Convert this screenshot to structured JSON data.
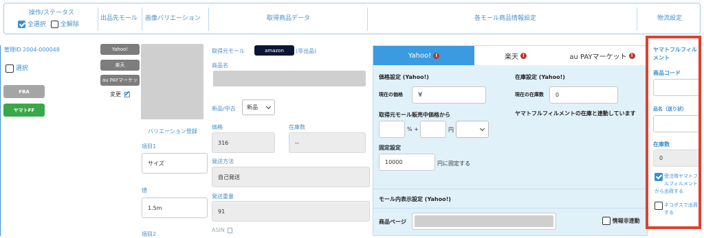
{
  "header": {
    "ops_status": "操作/ステータス",
    "select_all": "全選択",
    "deselect_all": "全解除",
    "target_mall": "出品先モール",
    "image_variation": "画像バリエーション",
    "acquired_data": "取得商品データ",
    "mall_settings": "各モール商品情報設定",
    "logistics": "物流設定"
  },
  "left": {
    "manage_id": "管理ID 2004-000048",
    "select_label": "選択",
    "fba_label": "FBA",
    "yamato_label": "ヤマトFF"
  },
  "malls": {
    "yahoo": "Yahoo!",
    "rakuten": "楽天",
    "aupay": "au PAYマーケッ",
    "change": "変更"
  },
  "variation": {
    "register": "バリエーション登録",
    "item1_label": "項目1",
    "item1_value": "サイズ",
    "value_label": "値",
    "value_value": "1.5m",
    "item2_label": "項目2"
  },
  "acquired": {
    "source_label": "取得元モール",
    "source_badge": "amazon",
    "not_listed": "(非出品)",
    "product_name_label": "商品名",
    "condition_label": "新品/中古",
    "condition_value": "新品",
    "price_label": "価格",
    "price_value": "316",
    "stock_label": "在庫数",
    "stock_value": "--",
    "shipping_method_label": "発送方法",
    "shipping_method_value": "自己発送",
    "shipping_weight_label": "発送重量",
    "shipping_weight_value": "91",
    "asin_label": "ASIN"
  },
  "tabs": {
    "yahoo": "Yahoo!",
    "rakuten": "楽天",
    "aupay": "au PAYマーケット"
  },
  "yahoo_panel": {
    "price_setting": "価格設定 (Yahoo!)",
    "current_price_label": "現在の価格",
    "current_price_value": "¥",
    "stock_setting": "在庫設定 (Yahoo!)",
    "current_stock_label": "現在の在庫数",
    "current_stock_value": "0",
    "from_source_price": "取得元モール販売中価格から",
    "percent_plus": "% +",
    "yen": "円",
    "yamato_sync": "ヤマトフルフィルメントの在庫と連動しています",
    "fixed_setting": "固定設定",
    "fixed_value": "10000",
    "fixed_suffix": "円に固定する",
    "display_setting": "モール内表示設定 (Yahoo!)",
    "product_page": "商品ページ",
    "info_unlink": "情報非連動"
  },
  "logistics_panel": {
    "title": "ヤマトフルフィルメント",
    "product_code": "商品コード",
    "product_name": "品名（送り状）",
    "stock": "在庫数",
    "stock_value": "0",
    "ship_on_order": "受注時ヤマトフルフィルメントから出荷する",
    "nekopos": "ネコポスで出荷する"
  },
  "colors": {
    "accent": "#3b8fd1",
    "highlight_red": "#e0402f",
    "yahoo_tab": "#3b9be0",
    "yamato_green": "#3aa84a"
  }
}
